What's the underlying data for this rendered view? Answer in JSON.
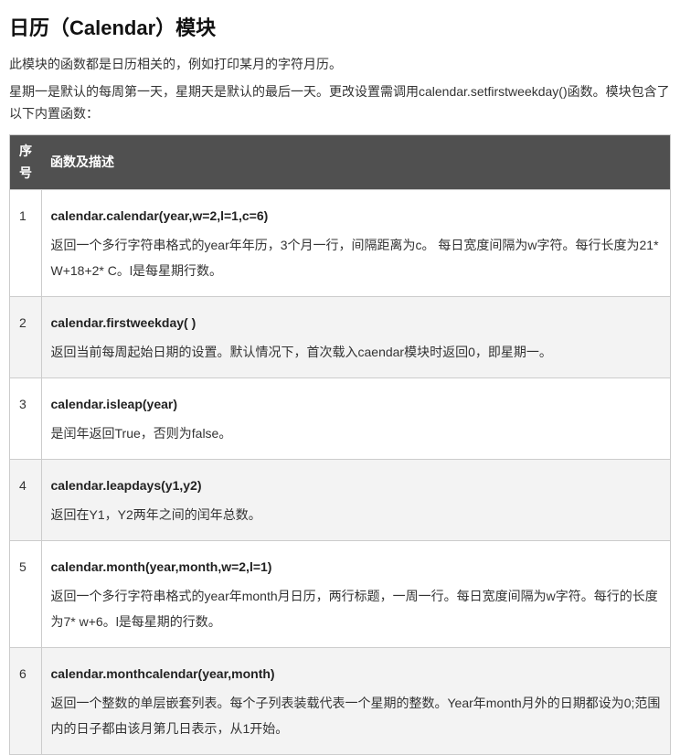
{
  "title": "日历（Calendar）模块",
  "intro": [
    "此模块的函数都是日历相关的，例如打印某月的字符月历。",
    "星期一是默认的每周第一天，星期天是默认的最后一天。更改设置需调用calendar.setfirstweekday()函数。模块包含了以下内置函数："
  ],
  "table": {
    "headers": [
      "序号",
      "函数及描述"
    ],
    "rows": [
      {
        "n": "1",
        "fn": "calendar.calendar(year,w=2,l=1,c=6)",
        "desc": "返回一个多行字符串格式的year年年历，3个月一行，间隔距离为c。 每日宽度间隔为w字符。每行长度为21* W+18+2* C。l是每星期行数。"
      },
      {
        "n": "2",
        "fn": "calendar.firstweekday( )",
        "desc": "返回当前每周起始日期的设置。默认情况下，首次载入caendar模块时返回0，即星期一。"
      },
      {
        "n": "3",
        "fn": "calendar.isleap(year)",
        "desc": "是闰年返回True，否则为false。"
      },
      {
        "n": "4",
        "fn": "calendar.leapdays(y1,y2)",
        "desc": "返回在Y1，Y2两年之间的闰年总数。"
      },
      {
        "n": "5",
        "fn": "calendar.month(year,month,w=2,l=1)",
        "desc": "返回一个多行字符串格式的year年month月日历，两行标题，一周一行。每日宽度间隔为w字符。每行的长度为7* w+6。l是每星期的行数。"
      },
      {
        "n": "6",
        "fn": "calendar.monthcalendar(year,month)",
        "desc": "返回一个整数的单层嵌套列表。每个子列表装载代表一个星期的整数。Year年month月外的日期都设为0;范围内的日子都由该月第几日表示，从1开始。"
      }
    ]
  }
}
